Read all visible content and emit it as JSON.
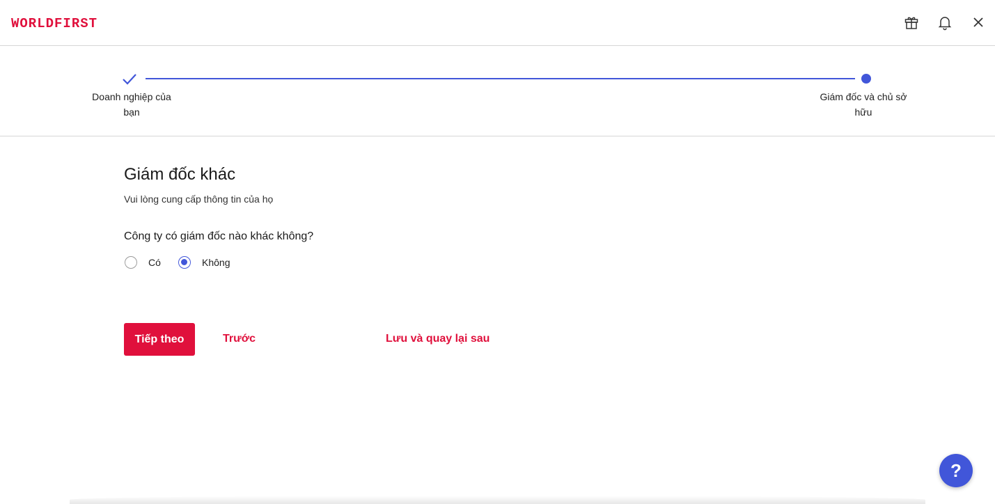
{
  "header": {
    "logo": "WORLDFIRST",
    "icons": [
      "gift-icon",
      "bell-icon",
      "close-icon"
    ]
  },
  "stepper": {
    "steps": [
      {
        "label": "Doanh nghiệp của bạn",
        "status": "completed"
      },
      {
        "label": "Giám đốc và chủ sở hữu",
        "status": "current"
      }
    ]
  },
  "main": {
    "title": "Giám đốc khác",
    "subtitle": "Vui lòng cung cấp thông tin của họ",
    "question": "Công ty có giám đốc nào khác không?",
    "options": [
      {
        "label": "Có",
        "selected": false
      },
      {
        "label": "Không",
        "selected": true
      }
    ]
  },
  "actions": {
    "next_label": "Tiếp theo",
    "prev_label": "Trước",
    "save_label": "Lưu và quay lại sau"
  },
  "help": {
    "label": "?"
  },
  "colors": {
    "brand": "#e0103c",
    "accent": "#4156d9"
  }
}
